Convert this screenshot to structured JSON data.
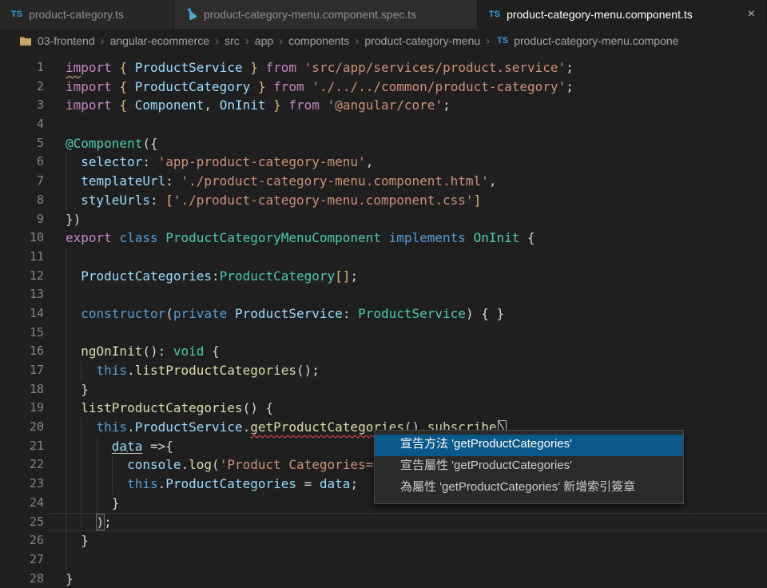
{
  "tabs": [
    {
      "label": "product-category.ts",
      "icon": "ts",
      "active": false,
      "closable": false
    },
    {
      "label": "product-category-menu.component.spec.ts",
      "icon": "flask",
      "active": false,
      "closable": false
    },
    {
      "label": "product-category-menu.component.ts",
      "icon": "ts",
      "active": true,
      "closable": true
    }
  ],
  "ui": {
    "close_glyph": "×",
    "breadcrumb_separator": "›"
  },
  "breadcrumb": {
    "folders": [
      "03-frontend",
      "angular-ecommerce",
      "src",
      "app",
      "components",
      "product-category-menu"
    ],
    "file": "product-category-menu.compone",
    "file_icon": "ts"
  },
  "editor": {
    "lines": [
      {
        "n": 1,
        "g": [],
        "segs": [
          [
            "im",
            "kw sqy"
          ],
          [
            "port",
            "kw"
          ],
          [
            " ",
            "pn"
          ],
          [
            "{",
            "br"
          ],
          [
            " ",
            "pn"
          ],
          [
            "ProductService",
            "vr"
          ],
          [
            " ",
            "pn"
          ],
          [
            "}",
            "br"
          ],
          [
            " ",
            "pn"
          ],
          [
            "from",
            "kw"
          ],
          [
            " ",
            "pn"
          ],
          [
            "'src/app/services/product.service'",
            "st"
          ],
          [
            ";",
            "pn"
          ]
        ]
      },
      {
        "n": 2,
        "g": [],
        "segs": [
          [
            "import",
            "kw"
          ],
          [
            " ",
            "pn"
          ],
          [
            "{",
            "br"
          ],
          [
            " ",
            "pn"
          ],
          [
            "ProductCategory",
            "vr"
          ],
          [
            " ",
            "pn"
          ],
          [
            "}",
            "br"
          ],
          [
            " ",
            "pn"
          ],
          [
            "from",
            "kw"
          ],
          [
            " ",
            "pn"
          ],
          [
            "'./../../common/product-category'",
            "st"
          ],
          [
            ";",
            "pn"
          ]
        ]
      },
      {
        "n": 3,
        "g": [],
        "segs": [
          [
            "import",
            "kw"
          ],
          [
            " ",
            "pn"
          ],
          [
            "{",
            "br"
          ],
          [
            " ",
            "pn"
          ],
          [
            "Component",
            "vr"
          ],
          [
            ", ",
            "pn"
          ],
          [
            "OnInit",
            "vr"
          ],
          [
            " ",
            "pn"
          ],
          [
            "}",
            "br"
          ],
          [
            " ",
            "pn"
          ],
          [
            "from",
            "kw"
          ],
          [
            " ",
            "pn"
          ],
          [
            "'@angular/core'",
            "st"
          ],
          [
            ";",
            "pn"
          ]
        ]
      },
      {
        "n": 4,
        "g": [],
        "segs": []
      },
      {
        "n": 5,
        "g": [],
        "segs": [
          [
            "@Component",
            "ty"
          ],
          [
            "({",
            "pn"
          ]
        ]
      },
      {
        "n": 6,
        "g": [
          0
        ],
        "segs": [
          [
            "  ",
            "pn"
          ],
          [
            "selector",
            "vr"
          ],
          [
            ": ",
            "pn"
          ],
          [
            "'app-product-category-menu'",
            "st"
          ],
          [
            ",",
            "pn"
          ]
        ]
      },
      {
        "n": 7,
        "g": [
          0
        ],
        "segs": [
          [
            "  ",
            "pn"
          ],
          [
            "templateUrl",
            "vr"
          ],
          [
            ": ",
            "pn"
          ],
          [
            "'./product-category-menu.component.html'",
            "st"
          ],
          [
            ",",
            "pn"
          ]
        ]
      },
      {
        "n": 8,
        "g": [
          0
        ],
        "segs": [
          [
            "  ",
            "pn"
          ],
          [
            "styleUrls",
            "vr"
          ],
          [
            ": ",
            "pn"
          ],
          [
            "[",
            "br"
          ],
          [
            "'./product-category-menu.component.css'",
            "st"
          ],
          [
            "]",
            "br"
          ]
        ]
      },
      {
        "n": 9,
        "g": [],
        "segs": [
          [
            "})",
            "pn"
          ]
        ]
      },
      {
        "n": 10,
        "g": [],
        "segs": [
          [
            "export",
            "kw"
          ],
          [
            " ",
            "pn"
          ],
          [
            "class",
            "kb"
          ],
          [
            " ",
            "pn"
          ],
          [
            "ProductCategoryMenuComponent",
            "ty"
          ],
          [
            " ",
            "pn"
          ],
          [
            "implements",
            "kb"
          ],
          [
            " ",
            "pn"
          ],
          [
            "OnInit",
            "ty"
          ],
          [
            " {",
            "pn"
          ]
        ]
      },
      {
        "n": 11,
        "g": [
          0
        ],
        "segs": []
      },
      {
        "n": 12,
        "g": [
          0
        ],
        "segs": [
          [
            "  ",
            "pn"
          ],
          [
            "ProductCategories",
            "vr"
          ],
          [
            ":",
            "pn"
          ],
          [
            "ProductCategory",
            "ty"
          ],
          [
            "[]",
            "br"
          ],
          [
            ";",
            "pn"
          ]
        ]
      },
      {
        "n": 13,
        "g": [
          0
        ],
        "segs": []
      },
      {
        "n": 14,
        "g": [
          0
        ],
        "segs": [
          [
            "  ",
            "pn"
          ],
          [
            "constructor",
            "kb"
          ],
          [
            "(",
            "pn"
          ],
          [
            "private",
            "kb"
          ],
          [
            " ",
            "pn"
          ],
          [
            "ProductService",
            "vr"
          ],
          [
            ": ",
            "pn"
          ],
          [
            "ProductService",
            "ty"
          ],
          [
            ") { }",
            "pn"
          ]
        ]
      },
      {
        "n": 15,
        "g": [
          0
        ],
        "segs": []
      },
      {
        "n": 16,
        "g": [
          0
        ],
        "segs": [
          [
            "  ",
            "pn"
          ],
          [
            "ngOnInit",
            "fn"
          ],
          [
            "(): ",
            "pn"
          ],
          [
            "void",
            "ty"
          ],
          [
            " {",
            "pn"
          ]
        ]
      },
      {
        "n": 17,
        "g": [
          0,
          2
        ],
        "segs": [
          [
            "    ",
            "pn"
          ],
          [
            "this",
            "kb"
          ],
          [
            ".",
            "pn"
          ],
          [
            "listProductCategories",
            "fn"
          ],
          [
            "();",
            "pn"
          ]
        ]
      },
      {
        "n": 18,
        "g": [
          0
        ],
        "segs": [
          [
            "  }",
            "pn"
          ]
        ]
      },
      {
        "n": 19,
        "g": [
          0
        ],
        "segs": [
          [
            "  ",
            "pn"
          ],
          [
            "listProductCategories",
            "fn"
          ],
          [
            "() {",
            "pn"
          ]
        ]
      },
      {
        "n": 20,
        "g": [
          0,
          2
        ],
        "segs": [
          [
            "    ",
            "pn"
          ],
          [
            "this",
            "kb"
          ],
          [
            ".",
            "pn"
          ],
          [
            "ProductService",
            "vr"
          ],
          [
            ".",
            "pn"
          ],
          [
            "getProductCategories",
            "fn sqr"
          ],
          [
            "().",
            "pn"
          ],
          [
            "subscribe",
            "fn"
          ],
          [
            "",
            "bx"
          ]
        ]
      },
      {
        "n": 21,
        "g": [
          0,
          2,
          4
        ],
        "segs": [
          [
            "      ",
            "pn"
          ],
          [
            "data",
            "vr dots"
          ],
          [
            " =>",
            "pn"
          ],
          [
            "{",
            "pn"
          ]
        ]
      },
      {
        "n": 22,
        "g": [
          0,
          2,
          4,
          6
        ],
        "segs": [
          [
            "        ",
            "pn"
          ],
          [
            "console",
            "vr"
          ],
          [
            ".",
            "pn"
          ],
          [
            "log",
            "fn"
          ],
          [
            "(",
            "pn"
          ],
          [
            "'Product Categories=",
            "st"
          ]
        ]
      },
      {
        "n": 23,
        "g": [
          0,
          2,
          4,
          6
        ],
        "segs": [
          [
            "        ",
            "pn"
          ],
          [
            "this",
            "kb"
          ],
          [
            ".",
            "pn"
          ],
          [
            "ProductCategories",
            "vr"
          ],
          [
            " = ",
            "pn"
          ],
          [
            "data",
            "vr"
          ],
          [
            ";",
            "pn"
          ]
        ]
      },
      {
        "n": 24,
        "g": [
          0,
          2,
          4
        ],
        "segs": [
          [
            "      }",
            "pn"
          ]
        ]
      },
      {
        "n": 25,
        "g": [
          0,
          2
        ],
        "cur": true,
        "segs": [
          [
            "    ",
            "pn"
          ],
          [
            ")",
            "pn mbox"
          ],
          [
            ";",
            "pn"
          ]
        ]
      },
      {
        "n": 26,
        "g": [
          0
        ],
        "segs": [
          [
            "  }",
            "pn"
          ]
        ]
      },
      {
        "n": 27,
        "g": [
          0
        ],
        "segs": []
      },
      {
        "n": 28,
        "g": [],
        "segs": [
          [
            "}",
            "pn"
          ]
        ]
      }
    ]
  },
  "quickfix_menu": {
    "items": [
      {
        "label": "宣告方法 'getProductCategories'",
        "selected": true
      },
      {
        "label": "宣告屬性 'getProductCategories'",
        "selected": false
      },
      {
        "label": "為屬性 'getProductCategories' 新增索引簽章",
        "selected": false
      }
    ]
  },
  "colors": {
    "editor_bg": "#1F1F1F",
    "tabbar_bg": "#252526",
    "selected_item_bg": "#0A5789",
    "selected_item_fg": "#FFFFFF",
    "error_squiggle": "#F14C4C",
    "warning_squiggle": "#D7BA7D",
    "ts_icon_blue": "#3C9CD7",
    "flask_icon_blue": "#4FA3D1",
    "folder_icon_tan": "#C8A465",
    "line_number": "#858585",
    "syntax": {
      "kw": "#C586C0",
      "kb": "#569CD6",
      "ty": "#4EC9B0",
      "vr": "#9CDCFE",
      "fn": "#DCDCAA",
      "st": "#CE9178",
      "pn": "#D4D4D4",
      "br": "#DDB67A"
    }
  }
}
